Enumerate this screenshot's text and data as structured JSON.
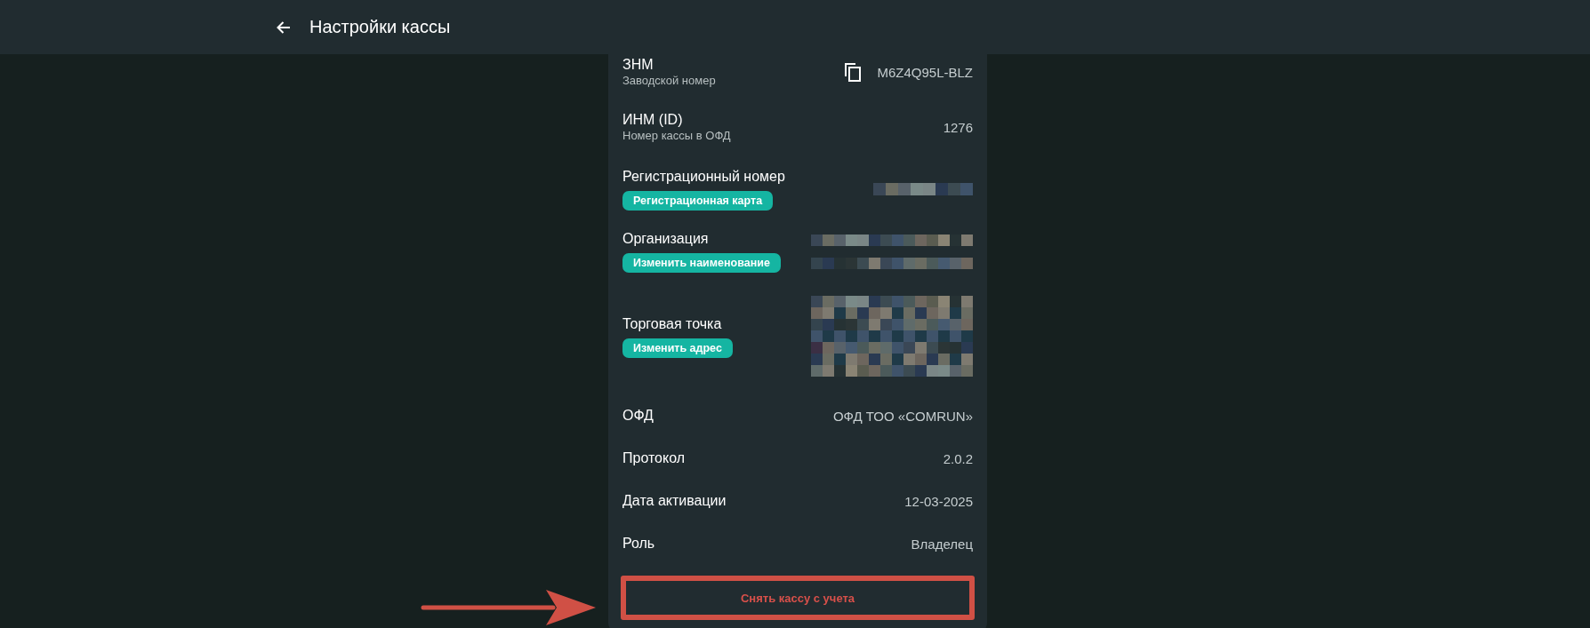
{
  "header": {
    "title": "Настройки кассы"
  },
  "rows": [
    {
      "kind": "copy",
      "title": "ЗНМ",
      "subtitle": "Заводской номер",
      "value": "M6Z4Q95L-BLZ"
    },
    {
      "kind": "plain",
      "title": "ИНМ (ID)",
      "subtitle": "Номер кассы в ОФД",
      "value": "1276"
    },
    {
      "kind": "redacted_short",
      "title": "Регистрационный номер",
      "action": "Регистрационная карта"
    },
    {
      "kind": "redacted_lines",
      "title": "Организация",
      "action": "Изменить наименование"
    },
    {
      "kind": "redacted_block",
      "title": "Торговая точка",
      "action": "Изменить адрес"
    },
    {
      "kind": "plain",
      "title": "ОФД",
      "value": "ОФД ТОО «COMRUN»"
    },
    {
      "kind": "plain",
      "title": "Протокол",
      "value": "2.0.2"
    },
    {
      "kind": "plain",
      "title": "Дата активации",
      "value": "12-03-2025"
    },
    {
      "kind": "plain",
      "title": "Роль",
      "value": "Владелец"
    }
  ],
  "deregister_button": {
    "label": "Снять кассу с учета",
    "highlighted": true
  }
}
